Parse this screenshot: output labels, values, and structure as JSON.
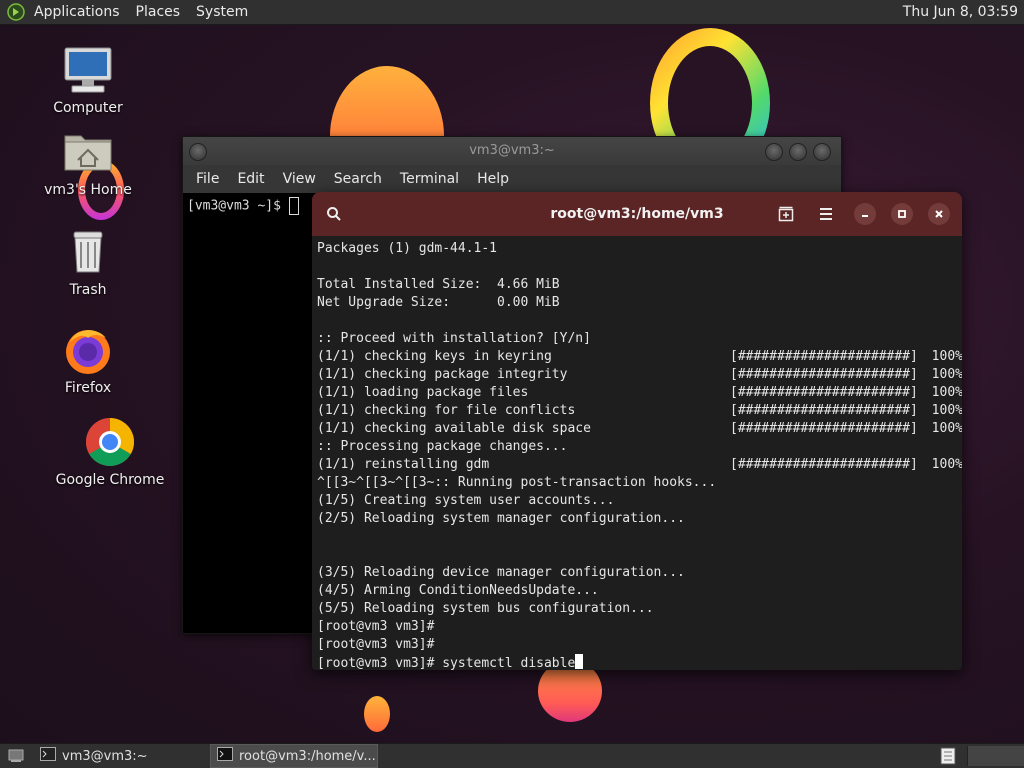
{
  "top_panel": {
    "menus": [
      "Applications",
      "Places",
      "System"
    ],
    "clock": "Thu Jun  8, 03:59"
  },
  "desktop_icons": [
    {
      "label": "Computer",
      "icon": "computer-icon"
    },
    {
      "label": "vm3's Home",
      "icon": "home-folder-icon"
    },
    {
      "label": "Trash",
      "icon": "trash-icon"
    },
    {
      "label": "Firefox",
      "icon": "firefox-icon"
    },
    {
      "label": "Google Chrome",
      "icon": "chrome-icon"
    }
  ],
  "mate_terminal": {
    "title": "vm3@vm3:~",
    "menu": [
      "File",
      "Edit",
      "View",
      "Search",
      "Terminal",
      "Help"
    ],
    "prompt": "[vm3@vm3 ~]$ "
  },
  "gnome_terminal": {
    "title": "root@vm3:/home/vm3",
    "lines": [
      {
        "text": "Packages (1) gdm-44.1-1"
      },
      {
        "text": ""
      },
      {
        "text": "Total Installed Size:  4.66 MiB"
      },
      {
        "text": "Net Upgrade Size:      0.00 MiB"
      },
      {
        "text": ""
      },
      {
        "text": ":: Proceed with installation? [Y/n]"
      },
      {
        "text": "(1/1) checking keys in keyring",
        "bar": "[######################]",
        "pct": "100%"
      },
      {
        "text": "(1/1) checking package integrity",
        "bar": "[######################]",
        "pct": "100%"
      },
      {
        "text": "(1/1) loading package files",
        "bar": "[######################]",
        "pct": "100%"
      },
      {
        "text": "(1/1) checking for file conflicts",
        "bar": "[######################]",
        "pct": "100%"
      },
      {
        "text": "(1/1) checking available disk space",
        "bar": "[######################]",
        "pct": "100%"
      },
      {
        "text": ":: Processing package changes..."
      },
      {
        "text": "(1/1) reinstalling gdm",
        "bar": "[######################]",
        "pct": "100%"
      },
      {
        "text": "^[[3~^[[3~^[[3~:: Running post-transaction hooks..."
      },
      {
        "text": "(1/5) Creating system user accounts..."
      },
      {
        "text": "(2/5) Reloading system manager configuration..."
      },
      {
        "text": ""
      },
      {
        "text": ""
      },
      {
        "text": "(3/5) Reloading device manager configuration..."
      },
      {
        "text": "(4/5) Arming ConditionNeedsUpdate..."
      },
      {
        "text": "(5/5) Reloading system bus configuration..."
      },
      {
        "text": "[root@vm3 vm3]#"
      },
      {
        "text": "[root@vm3 vm3]#"
      }
    ],
    "prompt_line": "[root@vm3 vm3]# systemctl disable"
  },
  "taskbar": {
    "items": [
      "vm3@vm3:~",
      "root@vm3:/home/v..."
    ]
  }
}
